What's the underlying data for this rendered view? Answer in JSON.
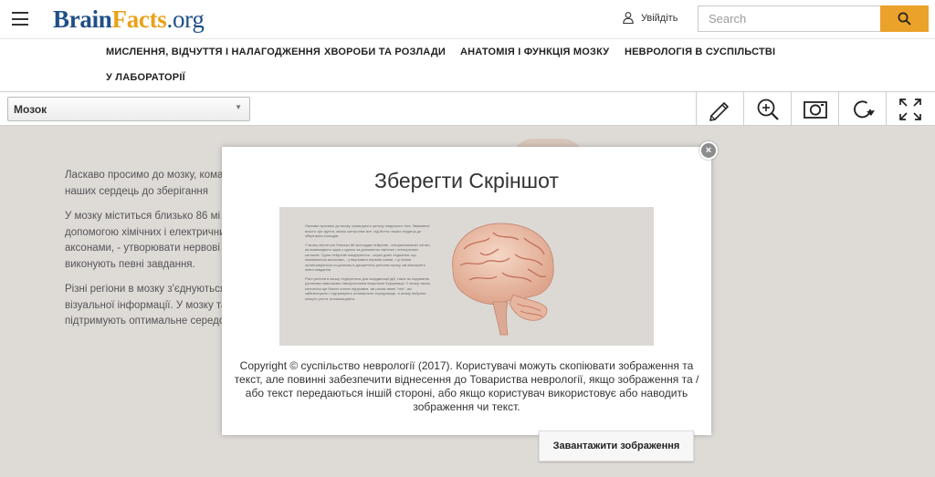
{
  "header": {
    "logo": {
      "part1": "Brain",
      "part2": "Facts",
      "part3": ".org"
    },
    "login_label": "Увійдіть",
    "search_placeholder": "Search"
  },
  "nav": {
    "items": [
      "МИСЛЕННЯ, ВІДЧУТТЯ І НАЛАГОДЖЕННЯ",
      "ХВОРОБИ ТА РОЗЛАДИ",
      "АНАТОМІЯ І ФУНКЦІЯ МОЗКУ",
      "НЕВРОЛОГІЯ В СУСПІЛЬСТВІ",
      "У ЛАБОРАТОРІЇ"
    ]
  },
  "toolbar": {
    "selected_model": "Мозок",
    "tools": [
      "pencil-icon",
      "zoom-in-icon",
      "camera-icon",
      "rotate-icon",
      "fullscreen-icon"
    ]
  },
  "background": {
    "paragraphs": [
      "Ласкаво просимо до мозку, кома тіла. Зважаючи всього три фунти биття наших сердець до зберігання",
      "У мозку міститься близько 86 мі спеціалізованих клітин, які взаєм допомогою хімічних і електричних поєднуються - через довгі з'єдна аксонами, - утворювати нервові організовуються по-різному в ди виконують певні завдання.",
      "Різні регіони в мозку з'єднуються як керування руховими навичкам візуальної інформації. У мозку та клітин підтримки, які разом звані підтримують оптимальне середо можуть рости та взаємодіяти."
    ]
  },
  "modal": {
    "title": "Зберегти Скріншот",
    "copyright": "Copyright © суспільство неврології (2017). Користувачі можуть скопіювати зображення та текст, але повинні забезпечити віднесення до Товариства неврології, якщо зображення та / або текст передаються іншій стороні, або якщо користувач використовує або наводить зображення чи текст.",
    "download_label": "Завантажити зображення",
    "close_label": "×",
    "preview_paragraphs": [
      "Ласкаво просимо до мозку, командного центру людського тіла. Зважаючи всього три фунти, мозок контролює все, від биття наших сердець до зберігання спогадів.",
      "У мозку міститься близько 86 мільярдів нейронів - спеціалізованих клітин, які взаємодіють одна з одною за допомогою хімічних і електричних сигналів. Групи нейронів поєднуються - через довгі з'єднання, що називаються аксонами, - утворювати нервові схеми, і ці схеми організовуються по-різному в дискретних регіонах мозку, які виконують певні завдання.",
      "Різні регіони в мозку з'єднуються для координації дій, таких як керування руховими навичками і використання візуальної інформації. У мозку також містяться ще багато клітин підтримки, які разом звані \"глія\", які забезпечують і підтримують оптимальне середовище, в якому нейрони можуть рости та взаємодіяти."
    ]
  },
  "colors": {
    "accent": "#eba22a",
    "logo_blue": "#1f4f86",
    "logo_orange": "#e9a21a",
    "content_bg": "#dedbd7"
  }
}
